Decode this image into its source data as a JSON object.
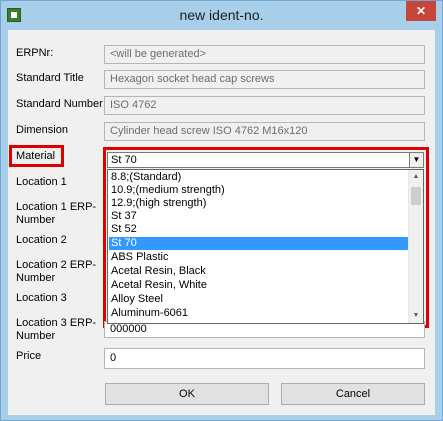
{
  "window": {
    "title": "new ident-no.",
    "close_symbol": "✕"
  },
  "form": {
    "erp_nr": {
      "label": "ERPNr:",
      "value": "<will be generated>"
    },
    "standard_title": {
      "label": "Standard Title",
      "value": "Hexagon socket head cap screws"
    },
    "standard_number": {
      "label": "Standard Number",
      "value": "ISO 4762"
    },
    "dimension": {
      "label": "Dimension",
      "value": "Cylinder head screw ISO 4762 M16x120"
    },
    "material": {
      "label": "Material",
      "value": "St 70"
    },
    "location1": {
      "label": "Location 1"
    },
    "location1_erp": {
      "label_line1": "Location 1 ERP-",
      "label_line2": "Number"
    },
    "location2": {
      "label": "Location 2"
    },
    "location2_erp": {
      "label_line1": "Location 2 ERP-",
      "label_line2": "Number"
    },
    "location3": {
      "label": "Location 3"
    },
    "location3_erp": {
      "label_line1": "Location 3 ERP-",
      "label_line2": "Number",
      "value": "000000"
    },
    "price": {
      "label": "Price",
      "value": "0"
    }
  },
  "material_dropdown": {
    "items": [
      "8.8;(Standard)",
      "10.9;(medium strength)",
      "12.9;(high strength)",
      "St 37",
      "St 52",
      "St 70",
      "ABS Plastic",
      "Acetal Resin, Black",
      "Acetal Resin, White",
      "Alloy Steel",
      "Aluminum-6061"
    ],
    "selected": "St 70"
  },
  "buttons": {
    "ok": "OK",
    "cancel": "Cancel"
  },
  "colors": {
    "selection": "#3399ff",
    "highlight": "#e00000",
    "close_button": "#c7463b"
  }
}
